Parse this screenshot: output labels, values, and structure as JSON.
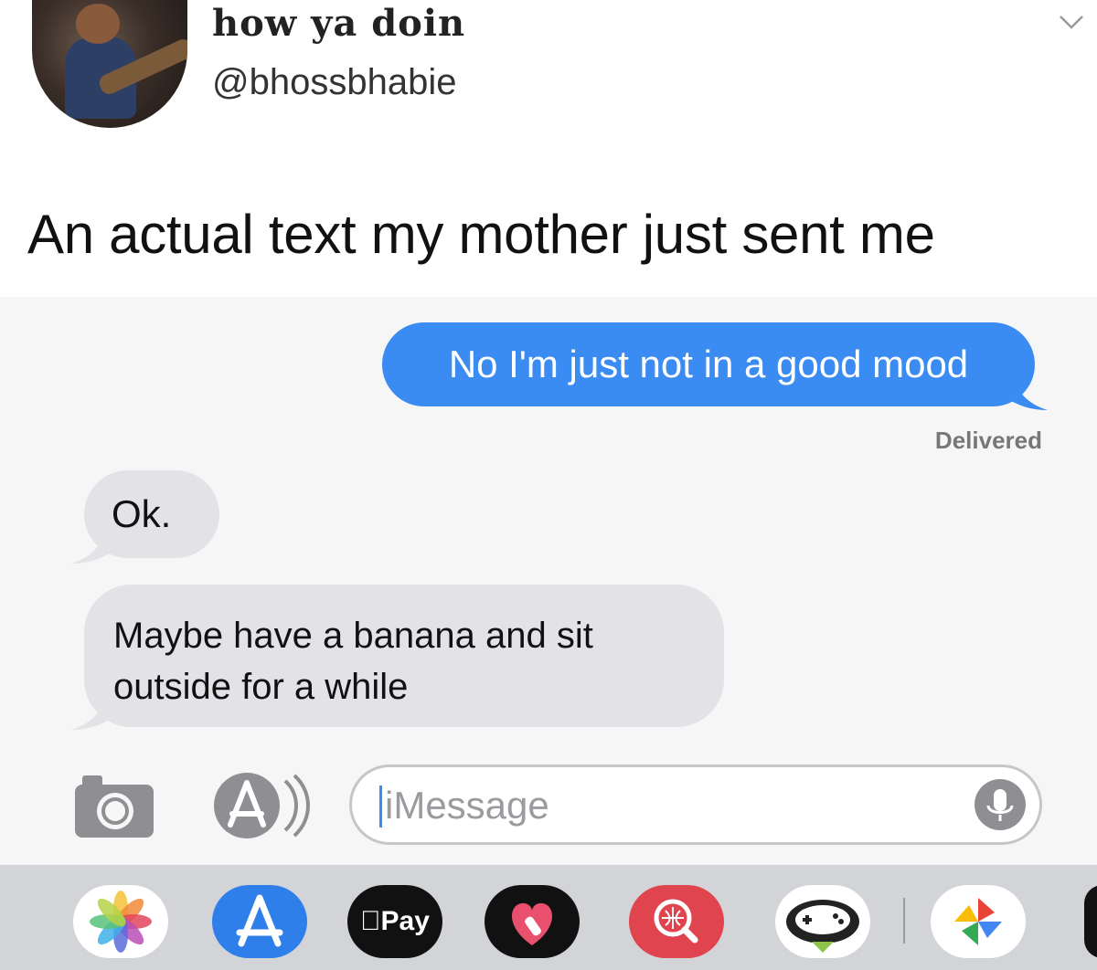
{
  "tweet": {
    "display_name": "how ya doin",
    "handle": "@bhossbhabie",
    "text": "An actual text my mother just sent me"
  },
  "conversation": {
    "outgoing": [
      {
        "text": "No I'm just not in a good mood",
        "status": "Delivered"
      }
    ],
    "incoming": [
      {
        "lines": [
          "Ok."
        ]
      },
      {
        "lines": [
          "Maybe have a banana and sit",
          "outside for a while"
        ]
      }
    ]
  },
  "composer": {
    "placeholder": "iMessage"
  },
  "app_drawer": {
    "apps": [
      {
        "icon": "photos-icon"
      },
      {
        "icon": "app-store-icon"
      },
      {
        "icon": "apple-pay-icon",
        "label": "Pay"
      },
      {
        "icon": "digital-touch-heart-icon"
      },
      {
        "icon": "image-search-icon"
      },
      {
        "icon": "game-controller-bird-icon"
      },
      {
        "icon": "pinwheel-icon"
      }
    ]
  },
  "colors": {
    "outgoing_bubble": "#3a8bf2",
    "incoming_bubble": "#e3e3e7",
    "app_drawer": "#d3d4d8"
  }
}
